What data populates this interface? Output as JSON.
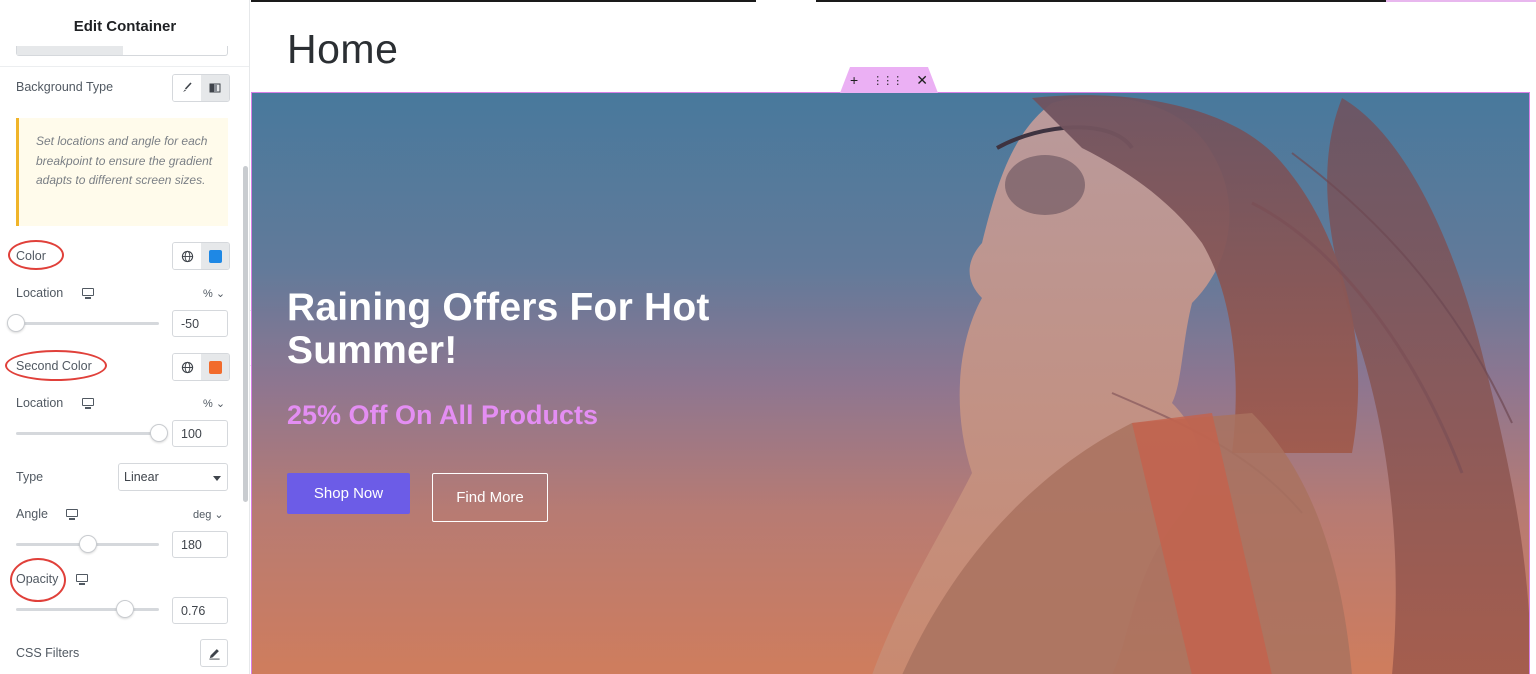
{
  "panel": {
    "title": "Edit Container",
    "background_type": {
      "label": "Background Type",
      "options": [
        "classic-brush-icon",
        "gradient-icon"
      ],
      "selected": "gradient"
    },
    "notice": "Set locations and angle for each breakpoint to ensure the gradient adapts to different screen sizes.",
    "color": {
      "label": "Color",
      "value": "#1e88e5"
    },
    "location1": {
      "label": "Location",
      "unit": "%",
      "value": "-50",
      "slider": 0
    },
    "second_color": {
      "label": "Second Color",
      "value": "#f26b2c"
    },
    "location2": {
      "label": "Location",
      "unit": "%",
      "value": "100",
      "slider": 1
    },
    "type": {
      "label": "Type",
      "value": "Linear"
    },
    "angle": {
      "label": "Angle",
      "unit": "deg",
      "value": "180",
      "slider": 0.5
    },
    "opacity": {
      "label": "Opacity",
      "value": "0.76",
      "slider": 0.76
    },
    "css_filters": {
      "label": "CSS Filters"
    }
  },
  "preview": {
    "page_title": "Home",
    "hero": {
      "heading": "Raining Offers For Hot Summer!",
      "subheading": "25% Off On All Products",
      "primary_button": "Shop Now",
      "secondary_button": "Find More"
    },
    "handle_icons": [
      "plus-icon",
      "drag-icon",
      "close-icon"
    ]
  },
  "colors": {
    "accent_purple": "#6c5ce7",
    "sub_pink": "#e48ef3",
    "handle_pink": "#ebb0f4",
    "annotation_red": "#e0403a"
  }
}
